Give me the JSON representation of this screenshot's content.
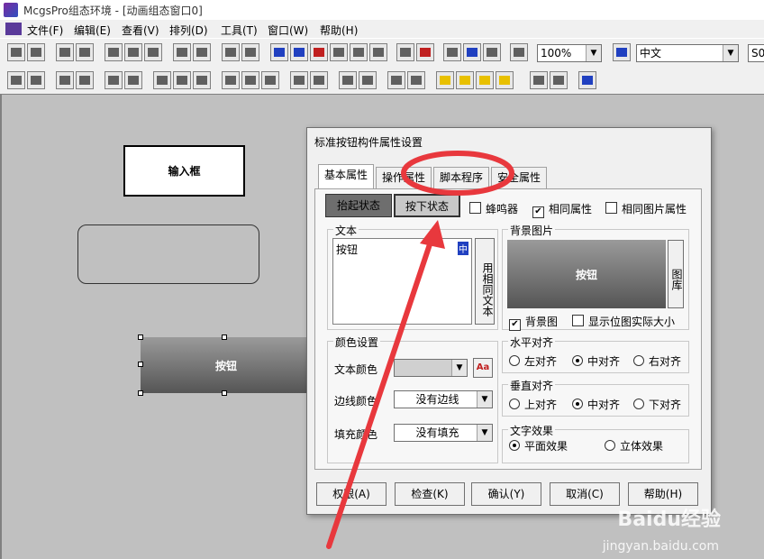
{
  "window": {
    "title": "McgsPro组态环境 - [动画组态窗口0]"
  },
  "menu": [
    "文件(F)",
    "编辑(E)",
    "查看(V)",
    "排列(D)",
    "工具(T)",
    "窗口(W)",
    "帮助(H)"
  ],
  "toolbar": {
    "zoom_value": "100%",
    "language_value": "中文",
    "extra_value": "S0"
  },
  "canvas": {
    "input_box_label": "输入框",
    "button_label": "按钮"
  },
  "dialog": {
    "title": "标准按钮构件属性设置",
    "tabs": [
      "基本属性",
      "操作属性",
      "脚本程序",
      "安全属性"
    ],
    "state_buttons": [
      "抬起状态",
      "按下状态"
    ],
    "checkboxes": {
      "buzzer": "蜂鸣器",
      "same_props": "相同属性",
      "same_image_props": "相同图片属性"
    },
    "text_group": {
      "label": "文本",
      "content": "按钮",
      "lang_badge": "中",
      "same_text_button": "用相同文本"
    },
    "background_group": {
      "label": "背景图片",
      "preview_text": "按钮",
      "library_button": "图库",
      "bg_checkbox": "背景图",
      "actual_size_checkbox": "显示位图实际大小"
    },
    "color_group": {
      "label": "颜色设置",
      "text_color_label": "文本颜色",
      "border_color_label": "边线颜色",
      "border_color_value": "没有边线",
      "fill_color_label": "填充颜色",
      "fill_color_value": "没有填充",
      "font_button": "Aa"
    },
    "h_align": {
      "label": "水平对齐",
      "options": [
        "左对齐",
        "中对齐",
        "右对齐"
      ]
    },
    "v_align": {
      "label": "垂直对齐",
      "options": [
        "上对齐",
        "中对齐",
        "下对齐"
      ]
    },
    "text_effect": {
      "label": "文字效果",
      "options": [
        "平面效果",
        "立体效果"
      ]
    },
    "footer_buttons": [
      "权限(A)",
      "检查(K)",
      "确认(Y)",
      "取消(C)",
      "帮助(H)"
    ]
  },
  "watermark": {
    "logo": "Baidu经验",
    "url": "jingyan.baidu.com"
  },
  "colors": {
    "annotation_red": "#e8383d",
    "dialog_bg": "#f0f0f0",
    "canvas_bg": "#c0c0c0"
  }
}
